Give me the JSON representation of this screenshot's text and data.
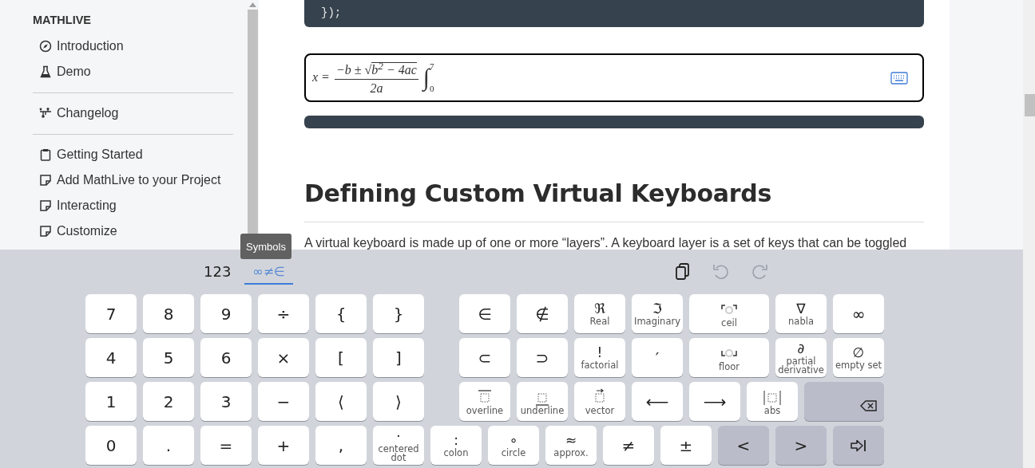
{
  "sidebar": {
    "title": "MATHLIVE",
    "groups": [
      [
        {
          "label": "Introduction",
          "kind": "compass"
        },
        {
          "label": "Demo",
          "kind": "flask"
        }
      ],
      [
        {
          "label": "Changelog",
          "kind": "nodes"
        }
      ],
      [
        {
          "label": "Getting Started",
          "kind": "clipboard"
        },
        {
          "label": "Add MathLive to your Project",
          "kind": "note"
        },
        {
          "label": "Interacting",
          "kind": "note"
        },
        {
          "label": "Customize",
          "kind": "note"
        }
      ]
    ]
  },
  "code_block": {
    "line": "});"
  },
  "math_field": {
    "lhs": "x =",
    "numerator": "−b ±",
    "radical": "√",
    "radicand": "b$^{2}$ − 4ac",
    "denominator": "2a",
    "integral": "∫",
    "upper_limit": "7",
    "lower_limit": "0"
  },
  "heading": "Defining Custom Virtual Keyboards",
  "paragraph": "A virtual keyboard is made up of one or more “layers”. A keyboard layer is a set of keys that can be toggled",
  "keyboard": {
    "tabs": [
      {
        "label": "123",
        "selected": false
      },
      {
        "label": "∞≠∈",
        "selected": true
      }
    ],
    "tooltip": "Symbols",
    "toolbar": [
      {
        "disabled": false
      },
      {
        "disabled": true
      },
      {
        "disabled": true
      }
    ],
    "rows": [
      {
        "blocks": [
          [
            {
              "glyph": "7"
            },
            {
              "glyph": "8"
            },
            {
              "glyph": "9"
            },
            {
              "glyph": "÷"
            },
            {
              "glyph": "{"
            },
            {
              "glyph": "}"
            }
          ],
          [
            {
              "glyph": "∈"
            },
            {
              "glyph": "∉"
            },
            {
              "glyph": "ℜ",
              "label": "Real"
            },
            {
              "glyph": "ℑ",
              "label": "Imaginary"
            },
            {
              "kind": "ceil",
              "label": "ceil"
            },
            {
              "glyph": "∇",
              "label": "nabla"
            },
            {
              "glyph": "∞"
            }
          ]
        ]
      },
      {
        "blocks": [
          [
            {
              "glyph": "4"
            },
            {
              "glyph": "5"
            },
            {
              "glyph": "6"
            },
            {
              "glyph": "×"
            },
            {
              "glyph": "["
            },
            {
              "glyph": "]"
            }
          ],
          [
            {
              "glyph": "⊂"
            },
            {
              "glyph": "⊃"
            },
            {
              "glyph": "!",
              "label": "factorial"
            },
            {
              "glyph": "′"
            },
            {
              "kind": "floor",
              "label": "floor"
            },
            {
              "glyph": "∂",
              "label": "partial derivative"
            },
            {
              "glyph": "∅",
              "label": "empty set"
            }
          ]
        ]
      },
      {
        "blocks": [
          [
            {
              "glyph": "1"
            },
            {
              "glyph": "2"
            },
            {
              "glyph": "3"
            },
            {
              "glyph": "−"
            },
            {
              "glyph": "⟨"
            },
            {
              "glyph": "⟩"
            }
          ],
          [
            {
              "kind": "overline",
              "label": "overline"
            },
            {
              "kind": "underline",
              "label": "underline"
            },
            {
              "kind": "vector",
              "label": "vector"
            },
            {
              "glyph": "⟵"
            },
            {
              "glyph": "⟶"
            },
            {
              "kind": "abs",
              "label": "abs"
            },
            {
              "kind": "backspace"
            }
          ]
        ]
      },
      {
        "blocks": [
          [
            {
              "glyph": "0"
            },
            {
              "glyph": "."
            },
            {
              "glyph": "="
            },
            {
              "glyph": "+"
            },
            {
              "glyph": ","
            },
            {
              "glyph": "·",
              "label": "centered dot"
            },
            {
              "glyph": ":",
              "label": "colon"
            },
            {
              "glyph": "∘",
              "label": "circle"
            },
            {
              "glyph": "≈",
              "label": "approx."
            },
            {
              "glyph": "≠"
            },
            {
              "glyph": "±"
            },
            {
              "glyph": "<",
              "kind": "action"
            },
            {
              "glyph": ">",
              "kind": "action"
            },
            {
              "kind": "tab"
            }
          ]
        ]
      }
    ]
  }
}
